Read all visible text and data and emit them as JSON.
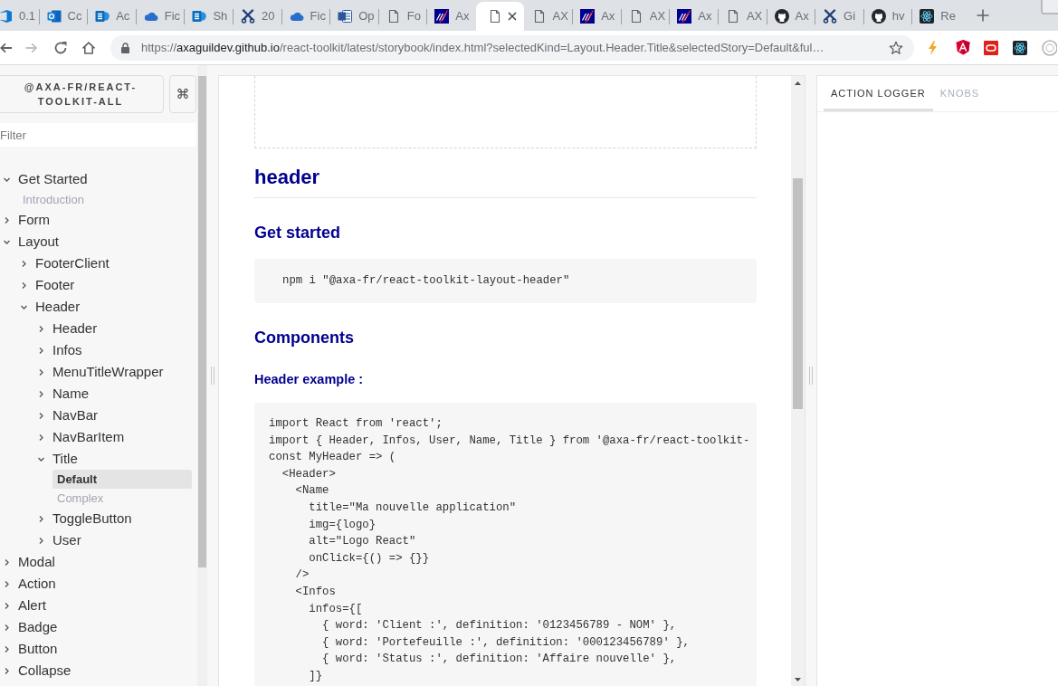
{
  "browser": {
    "tabs": [
      {
        "kind": "app",
        "label": "0.1",
        "selected": false
      },
      {
        "kind": "mail",
        "label": "Cc",
        "selected": false
      },
      {
        "kind": "list-tile",
        "label": "Ac",
        "selected": false
      },
      {
        "kind": "cloud",
        "label": "Fic",
        "selected": false
      },
      {
        "kind": "list-tile",
        "label": "Sh",
        "selected": false
      },
      {
        "kind": "scissors",
        "label": "20",
        "selected": false
      },
      {
        "kind": "cloud",
        "label": "Fic",
        "selected": false
      },
      {
        "kind": "word",
        "label": "Op",
        "selected": false
      },
      {
        "kind": "page",
        "label": "Fo",
        "selected": false
      },
      {
        "kind": "logo",
        "label": "Ax",
        "selected": false
      },
      {
        "kind": "page",
        "selected": true
      },
      {
        "kind": "page",
        "label": "AX",
        "selected": false
      },
      {
        "kind": "logo",
        "label": "Ax",
        "selected": false
      },
      {
        "kind": "page",
        "label": "AX",
        "selected": false
      },
      {
        "kind": "logo",
        "label": "Ax",
        "selected": false
      },
      {
        "kind": "page",
        "label": "AX",
        "selected": false
      },
      {
        "kind": "cat",
        "label": "Ax",
        "selected": false
      },
      {
        "kind": "scissors",
        "label": "Gi",
        "selected": false
      },
      {
        "kind": "cat",
        "label": "hv",
        "selected": false
      },
      {
        "kind": "atom",
        "label": "Re",
        "selected": false
      }
    ],
    "nav_buttons": [
      {
        "kind": "back",
        "disabled": false
      },
      {
        "kind": "forward",
        "disabled": true
      },
      {
        "kind": "reload",
        "disabled": false
      },
      {
        "kind": "home",
        "disabled": false
      }
    ],
    "address_bar": {
      "scheme": "https://",
      "host": "axaguildev.github.io",
      "path": "/react-toolkit/latest/storybook/index.html?selectedKind=Layout.Header.Title&selectedStory=Default&ful…"
    }
  },
  "storybook": {
    "sidebar": {
      "title": "@AXA-FR/REACT-TOOLKIT-ALL",
      "shortcut": "⌘",
      "filter": {
        "placeholder": "Filter"
      },
      "tree": [
        {
          "kind": "group",
          "label": "Get Started",
          "expanded": true,
          "children": [
            {
              "kind": "story",
              "label": "Introduction",
              "selected": false
            }
          ]
        },
        {
          "kind": "group",
          "label": "Form",
          "expanded": false
        },
        {
          "kind": "group",
          "label": "Layout",
          "expanded": true,
          "children": [
            {
              "kind": "group",
              "label": "FooterClient",
              "expanded": false
            },
            {
              "kind": "group",
              "label": "Footer",
              "expanded": false
            },
            {
              "kind": "group",
              "label": "Header",
              "expanded": true,
              "children": [
                {
                  "kind": "group",
                  "label": "Header",
                  "expanded": false
                },
                {
                  "kind": "group",
                  "label": "Infos",
                  "expanded": false
                },
                {
                  "kind": "group",
                  "label": "MenuTitleWrapper",
                  "expanded": false
                },
                {
                  "kind": "group",
                  "label": "Name",
                  "expanded": false
                },
                {
                  "kind": "group",
                  "label": "NavBar",
                  "expanded": false
                },
                {
                  "kind": "group",
                  "label": "NavBarItem",
                  "expanded": false
                },
                {
                  "kind": "group",
                  "label": "Title",
                  "expanded": true,
                  "children": [
                    {
                      "kind": "story",
                      "label": "Default",
                      "selected": true
                    },
                    {
                      "kind": "story",
                      "label": "Complex",
                      "selected": false
                    }
                  ]
                },
                {
                  "kind": "group",
                  "label": "ToggleButton",
                  "expanded": false
                },
                {
                  "kind": "group",
                  "label": "User",
                  "expanded": false
                }
              ]
            }
          ]
        },
        {
          "kind": "group",
          "label": "Modal",
          "expanded": false
        },
        {
          "kind": "group",
          "label": "Action",
          "expanded": false
        },
        {
          "kind": "group",
          "label": "Alert",
          "expanded": false
        },
        {
          "kind": "group",
          "label": "Badge",
          "expanded": false
        },
        {
          "kind": "group",
          "label": "Button",
          "expanded": false
        },
        {
          "kind": "group",
          "label": "Collapse",
          "expanded": false
        }
      ]
    },
    "preview": {
      "title": "header",
      "sections": [
        {
          "heading": "Get started",
          "blocks": [
            {
              "kind": "command",
              "text": "npm i \"@axa-fr/react-toolkit-layout-header\""
            }
          ]
        },
        {
          "heading": "Components",
          "blocks": [
            {
              "kind": "subheading",
              "text": "Header example :"
            },
            {
              "kind": "code",
              "text": "import React from 'react';\nimport { Header, Infos, User, Name, Title } from '@axa-fr/react-toolkit-\nconst MyHeader => (\n  <Header>\n    <Name\n      title=\"Ma nouvelle application\"\n      img={logo}\n      alt=\"Logo React\"\n      onClick={() => {}}\n    />\n    <Infos\n      infos={[\n        { word: 'Client :', definition: '0123456789 - NOM' },\n        { word: 'Portefeuille :', definition: '000123456789' },\n        { word: 'Status :', definition: 'Affaire nouvelle' },\n      ]}"
            }
          ]
        }
      ]
    },
    "addons": {
      "tabs": [
        {
          "label": "ACTION LOGGER",
          "selected": true
        },
        {
          "label": "KNOBS",
          "selected": false
        }
      ]
    }
  }
}
